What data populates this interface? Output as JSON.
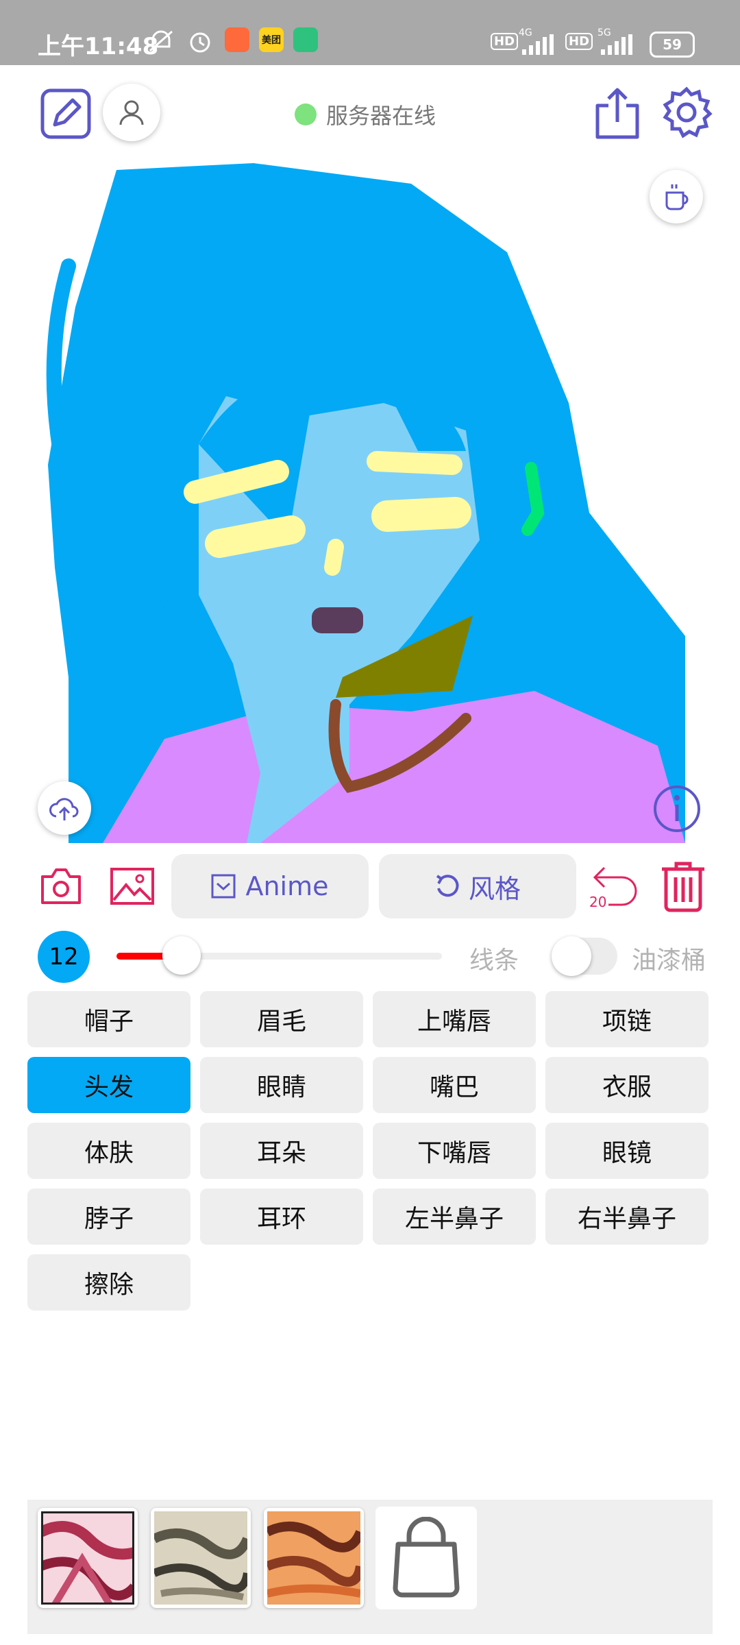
{
  "status_bar": {
    "time": "上午11:48",
    "meituan_label": "美团",
    "hd1": "HD",
    "net1": "4G",
    "hd2": "HD",
    "net2": "5G",
    "battery": "59"
  },
  "header": {
    "server_status": "服务器在线",
    "server_status_color": "#7ee27e"
  },
  "toolbar": {
    "anime_label": "Anime",
    "style_label": "风格",
    "undo_count": "20"
  },
  "brush": {
    "size": "12",
    "size_fraction": 0.12,
    "line_label": "线条",
    "bucket_label": "油漆桶",
    "bucket_on": false
  },
  "labels": [
    {
      "text": "帽子",
      "active": false
    },
    {
      "text": "眉毛",
      "active": false
    },
    {
      "text": "上嘴唇",
      "active": false
    },
    {
      "text": "项链",
      "active": false
    },
    {
      "text": "头发",
      "active": true
    },
    {
      "text": "眼睛",
      "active": false
    },
    {
      "text": "嘴巴",
      "active": false
    },
    {
      "text": "衣服",
      "active": false
    },
    {
      "text": "体肤",
      "active": false
    },
    {
      "text": "耳朵",
      "active": false
    },
    {
      "text": "下嘴唇",
      "active": false
    },
    {
      "text": "眼镜",
      "active": false
    },
    {
      "text": "脖子",
      "active": false
    },
    {
      "text": "耳环",
      "active": false
    },
    {
      "text": "左半鼻子",
      "active": false
    },
    {
      "text": "右半鼻子",
      "active": false
    },
    {
      "text": "擦除",
      "active": false
    }
  ],
  "colors": {
    "accent": "#5b57c7",
    "danger": "#e0245e",
    "hair": "#03a9f4",
    "skin": "#7fd0f7",
    "clothes": "#d98aff",
    "neck": "#808000",
    "necklace": "#8b4a2b",
    "eyes": "#fffaa0",
    "mouth": "#5a3d5c",
    "earring": "#00e676"
  },
  "icons": {
    "edit": "edit-icon",
    "user": "user-icon",
    "share": "share-icon",
    "settings": "gear-icon",
    "coffee": "coffee-icon",
    "upload": "cloud-upload-icon",
    "info": "info-icon",
    "camera": "camera-icon",
    "image": "image-icon",
    "undo": "undo-icon",
    "delete": "trash-icon",
    "bag": "shopping-bag-icon"
  }
}
